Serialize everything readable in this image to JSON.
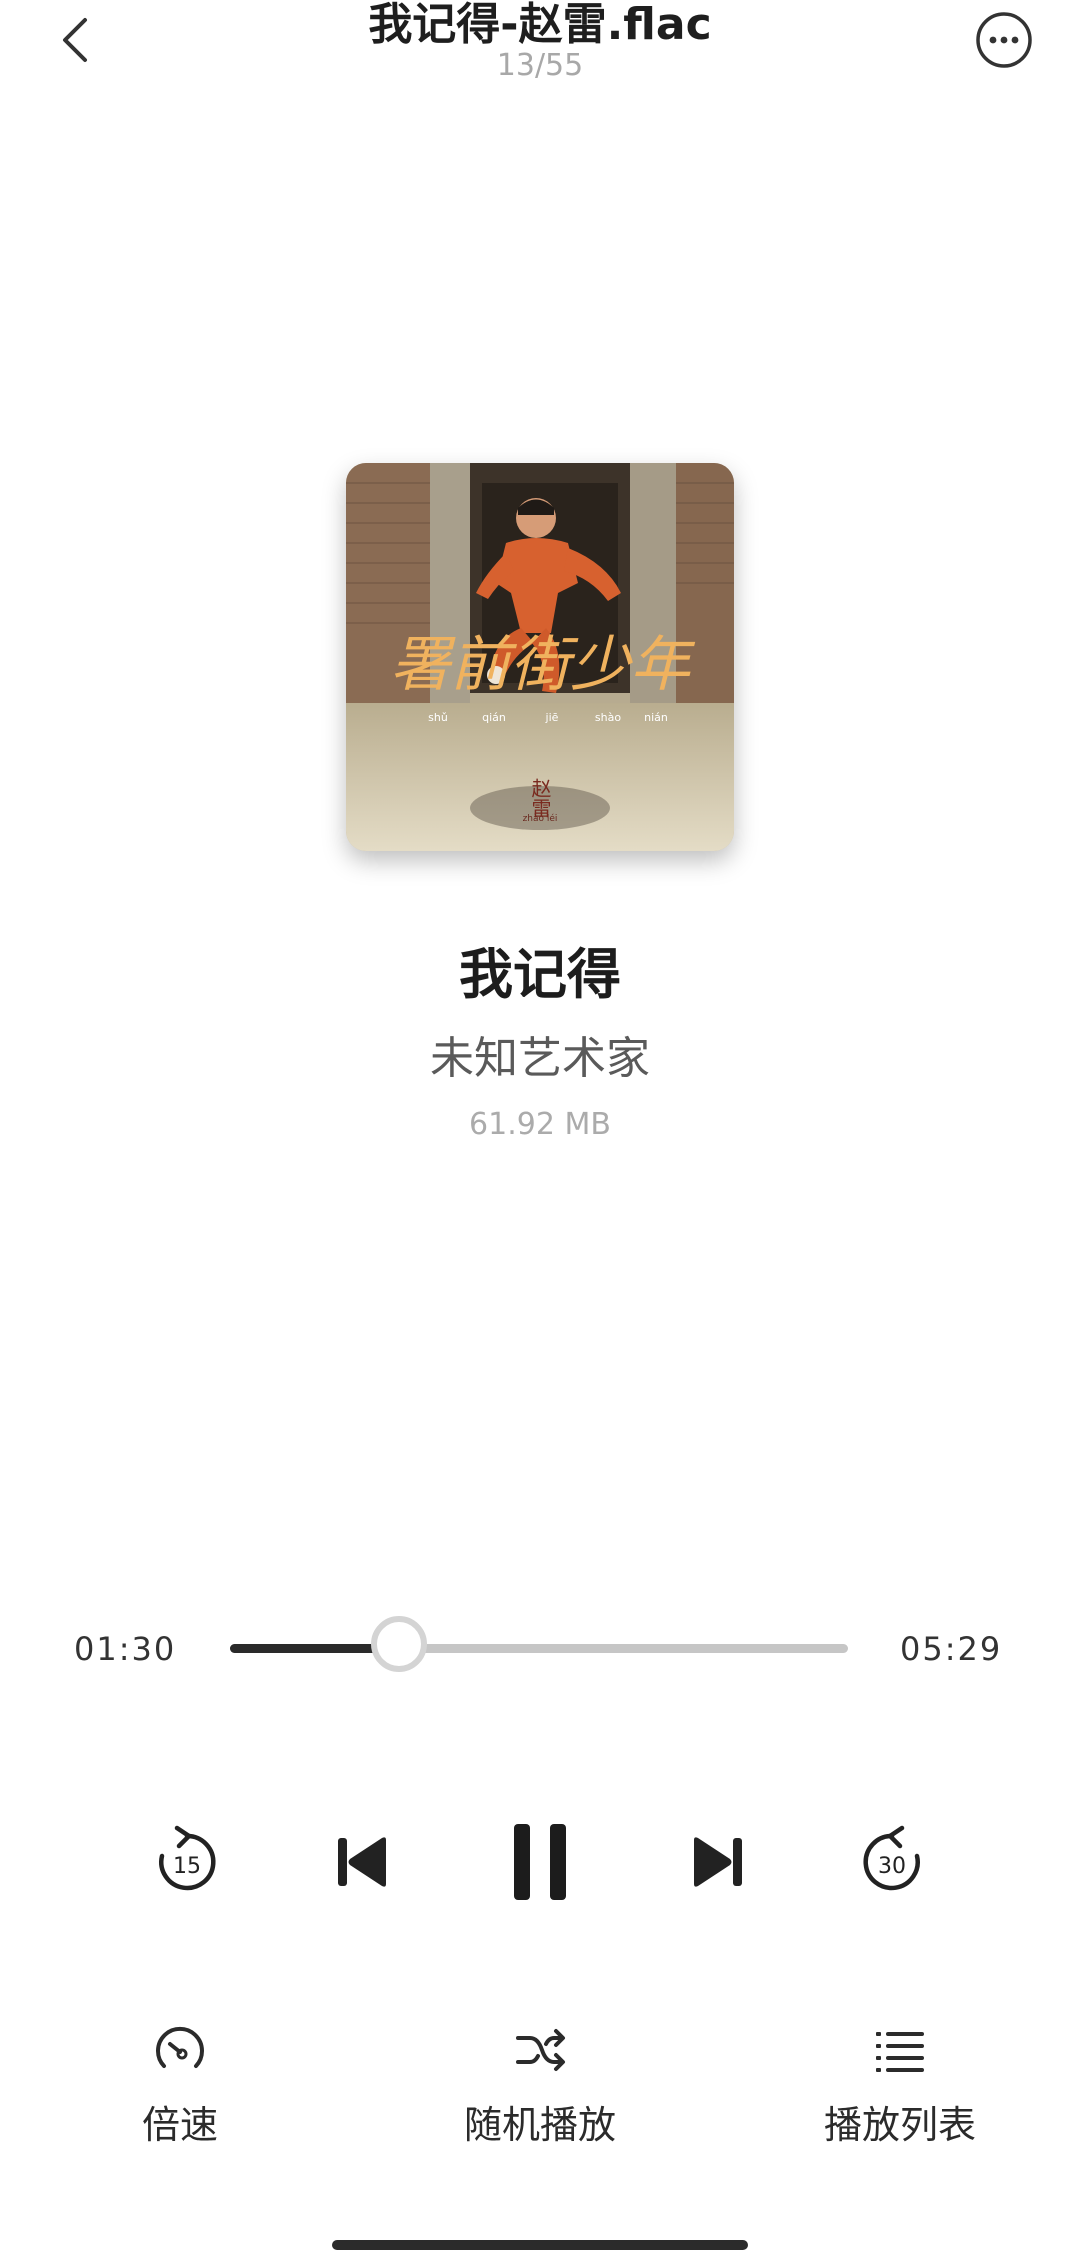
{
  "header": {
    "title": "我记得-赵雷.flac",
    "track_index": "13/55"
  },
  "album": {
    "title_text": "署前街少年",
    "pinyin": [
      "shǔ",
      "qián",
      "jiē",
      "shào",
      "nián"
    ],
    "artist_mark": "赵雷",
    "artist_pinyin": "zhào léi"
  },
  "song": {
    "title": "我记得",
    "artist": "未知艺术家",
    "size": "61.92 MB"
  },
  "progress": {
    "current": "01:30",
    "total": "05:29",
    "fraction": 0.273
  },
  "controls": {
    "skip_back_seconds": "15",
    "skip_forward_seconds": "30",
    "state": "playing"
  },
  "actions": {
    "speed": "倍速",
    "shuffle": "随机播放",
    "playlist": "播放列表"
  },
  "icons": {
    "back": "chevron-left-icon",
    "more": "more-circle-icon",
    "speed": "speedometer-icon",
    "shuffle": "shuffle-icon",
    "playlist": "list-icon"
  }
}
